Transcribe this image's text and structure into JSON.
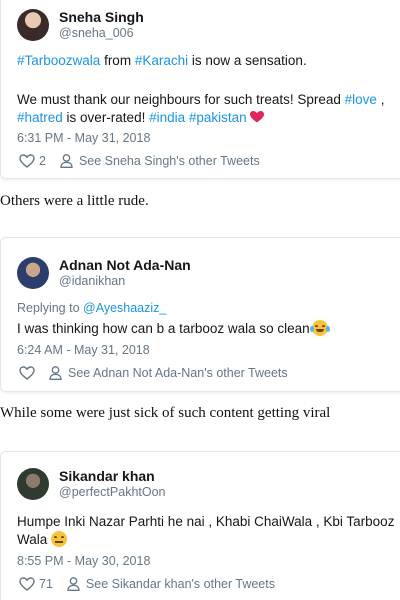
{
  "tweets": [
    {
      "name": "Sneha Singh",
      "handle": "@sneha_006",
      "line1": {
        "t1": "#Tarboozwala",
        "t2": " from ",
        "t3": "#Karachi",
        "t4": " is now a sensation."
      },
      "line2": {
        "t1": "We must thank our neighbours for such treats! Spread ",
        "t2": "#love",
        "t3": " ,"
      },
      "line3": {
        "t1": "#hatred",
        "t2": " is over-rated! ",
        "t3": "#india",
        "t4": " ",
        "t5": "#pakistan"
      },
      "time": "6:31 PM - May 31, 2018",
      "likes": "2",
      "other": "See Sneha Singh's other Tweets"
    },
    {
      "name": "Adnan Not Ada-Nan",
      "handle": "@idanikhan",
      "reply_prefix": "Replying to ",
      "reply_to": "@Ayeshaaziz_",
      "text": "I was thinking how can b a tarbooz wala so clean",
      "time": "6:24 AM - May 31, 2018",
      "other": "See Adnan Not Ada-Nan's other Tweets"
    },
    {
      "name": "Sikandar khan",
      "handle": "@perfectPakhtOon",
      "text1": "Humpe Inki Nazar Parhti he nai , Khabi ChaiWala , Kbi Tarbooz",
      "text2": "Wala",
      "time": "8:55 PM - May 30, 2018",
      "likes": "71",
      "other": "See Sikandar khan's other Tweets"
    }
  ],
  "captions": {
    "c1": "Others were a little rude.",
    "c2": "While some were just sick of such content getting viral"
  },
  "colors": {
    "link": "#1b95e0",
    "muted": "#657786",
    "heart": "#e0245e"
  }
}
